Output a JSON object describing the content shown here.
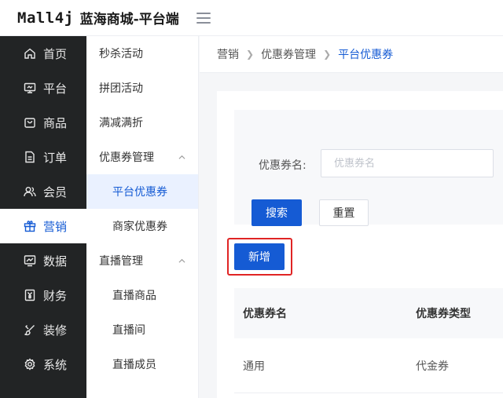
{
  "header": {
    "logo": "Mall4j",
    "title": "蓝海商城-平台端"
  },
  "sidebar": {
    "items": [
      {
        "label": "首页",
        "icon": "home-icon"
      },
      {
        "label": "平台",
        "icon": "monitor-icon"
      },
      {
        "label": "商品",
        "icon": "bag-icon"
      },
      {
        "label": "订单",
        "icon": "document-icon"
      },
      {
        "label": "会员",
        "icon": "users-icon"
      },
      {
        "label": "营销",
        "icon": "gift-icon",
        "active": true
      },
      {
        "label": "数据",
        "icon": "chart-icon"
      },
      {
        "label": "财务",
        "icon": "yuan-icon"
      },
      {
        "label": "装修",
        "icon": "brush-icon"
      },
      {
        "label": "系统",
        "icon": "gear-icon"
      }
    ]
  },
  "submenu": {
    "items": [
      {
        "label": "秒杀活动"
      },
      {
        "label": "拼团活动"
      },
      {
        "label": "满减满折"
      },
      {
        "label": "优惠券管理",
        "expanded": true
      },
      {
        "label": "平台优惠券",
        "active": true
      },
      {
        "label": "商家优惠券"
      },
      {
        "label": "直播管理",
        "expanded": true
      },
      {
        "label": "直播商品"
      },
      {
        "label": "直播间"
      },
      {
        "label": "直播成员"
      }
    ]
  },
  "breadcrumb": [
    "营销",
    "优惠券管理",
    "平台优惠券"
  ],
  "search": {
    "label": "优惠券名:",
    "placeholder": "优惠券名",
    "value": "",
    "search_button": "搜索",
    "reset_button": "重置"
  },
  "actions": {
    "add_button": "新增"
  },
  "table": {
    "headers": [
      "优惠券名",
      "优惠券类型"
    ],
    "rows": [
      [
        "通用",
        "代金券"
      ]
    ]
  },
  "colors": {
    "primary": "#155bd4",
    "sidebar_bg": "#222425",
    "highlight": "#e02424"
  }
}
